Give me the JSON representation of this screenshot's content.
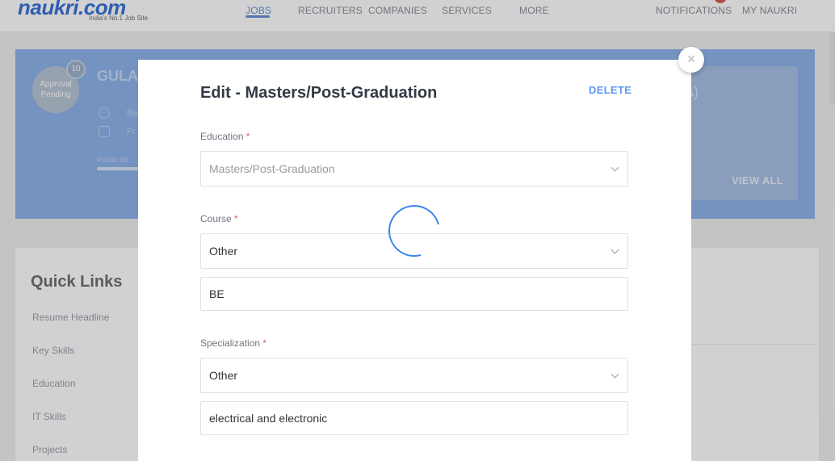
{
  "header": {
    "logo_text": "naukri.com",
    "logo_tagline": "India's No.1 Job Site",
    "nav": [
      "JOBS",
      "RECRUITERS",
      "COMPANIES",
      "SERVICES",
      "MORE"
    ],
    "notifications_label": "NOTIFICATIONS",
    "my_naukri_label": "MY NAUKRI"
  },
  "profile": {
    "avatar_text": "Approval Pending",
    "badge_text": "10",
    "name": "GULA",
    "line1": "Be",
    "line2": "Fr",
    "strength_label": "Profile Str",
    "pending_title": "s)",
    "view_all_label": "VIEW ALL"
  },
  "quick_links": {
    "title": "Quick Links",
    "items": [
      "Resume Headline",
      "Key Skills",
      "Education",
      "IT Skills",
      "Projects"
    ]
  },
  "modal": {
    "title": "Edit - Masters/Post-Graduation",
    "delete_label": "DELETE",
    "close_icon": "×",
    "education": {
      "label": "Education",
      "required": "*",
      "value": "Masters/Post-Graduation"
    },
    "course": {
      "label": "Course",
      "required": "*",
      "value": "Other",
      "other_value": "BE"
    },
    "specialization": {
      "label": "Specialization",
      "required": "*",
      "value": "Other",
      "other_value": "electrical and electronic"
    },
    "loading_icon": "spinner-icon"
  }
}
